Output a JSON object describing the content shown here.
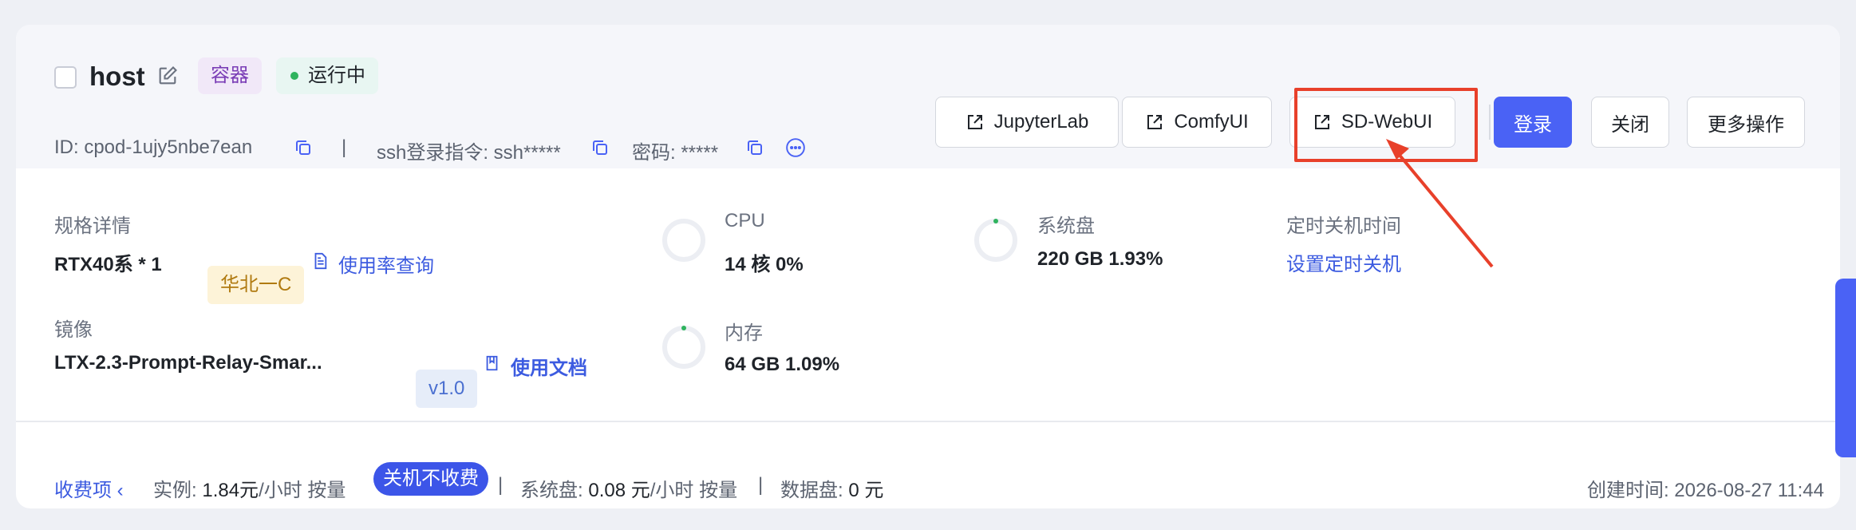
{
  "header": {
    "host_name": "host",
    "tag_type": "容器",
    "status": "运行中",
    "id_label": "ID: cpod-1ujy5nbe7ean",
    "separator": "|",
    "ssh_label": "ssh登录指令: ssh*****",
    "password_label": "密码: *****"
  },
  "actions": {
    "jupyterlab": "JupyterLab",
    "comfyui": "ComfyUI",
    "sdwebui": "SD-WebUI",
    "login": "登录",
    "close": "关闭",
    "more": "更多操作"
  },
  "spec": {
    "label": "规格详情",
    "value": "RTX40系 * 1",
    "region": "华北一C",
    "usage_link": "使用率查询"
  },
  "image": {
    "label": "镜像",
    "value": "LTX-2.3-Prompt-Relay-Smar...",
    "version": "v1.0",
    "docs_link": "使用文档"
  },
  "cpu": {
    "label": "CPU",
    "value": "14 核 0%",
    "percent": 0
  },
  "memory": {
    "label": "内存",
    "value": "64 GB 1.09%",
    "percent": 1.09
  },
  "disk": {
    "label": "系统盘",
    "value": "220 GB 1.93%",
    "percent": 1.93
  },
  "shutdown": {
    "label": "定时关机时间",
    "link": "设置定时关机"
  },
  "footer": {
    "fees_link": "收费项",
    "instance_label": "实例:",
    "instance_price": "1.84元",
    "per_hour": "/小时",
    "billing_mode": "按量",
    "no_charge_badge": "关机不收费",
    "sep": "|",
    "disk_label": "系统盘:",
    "disk_price": "0.08 元",
    "per_hour2": "/小时",
    "billing_mode2": "按量",
    "data_disk_label": "数据盘:",
    "data_disk_price": "0 元",
    "created": "创建时间: 2026-08-27 11:44"
  },
  "colors": {
    "primary": "#4a62f5",
    "status_dot": "#2fb35e",
    "highlight": "#e8402a"
  }
}
